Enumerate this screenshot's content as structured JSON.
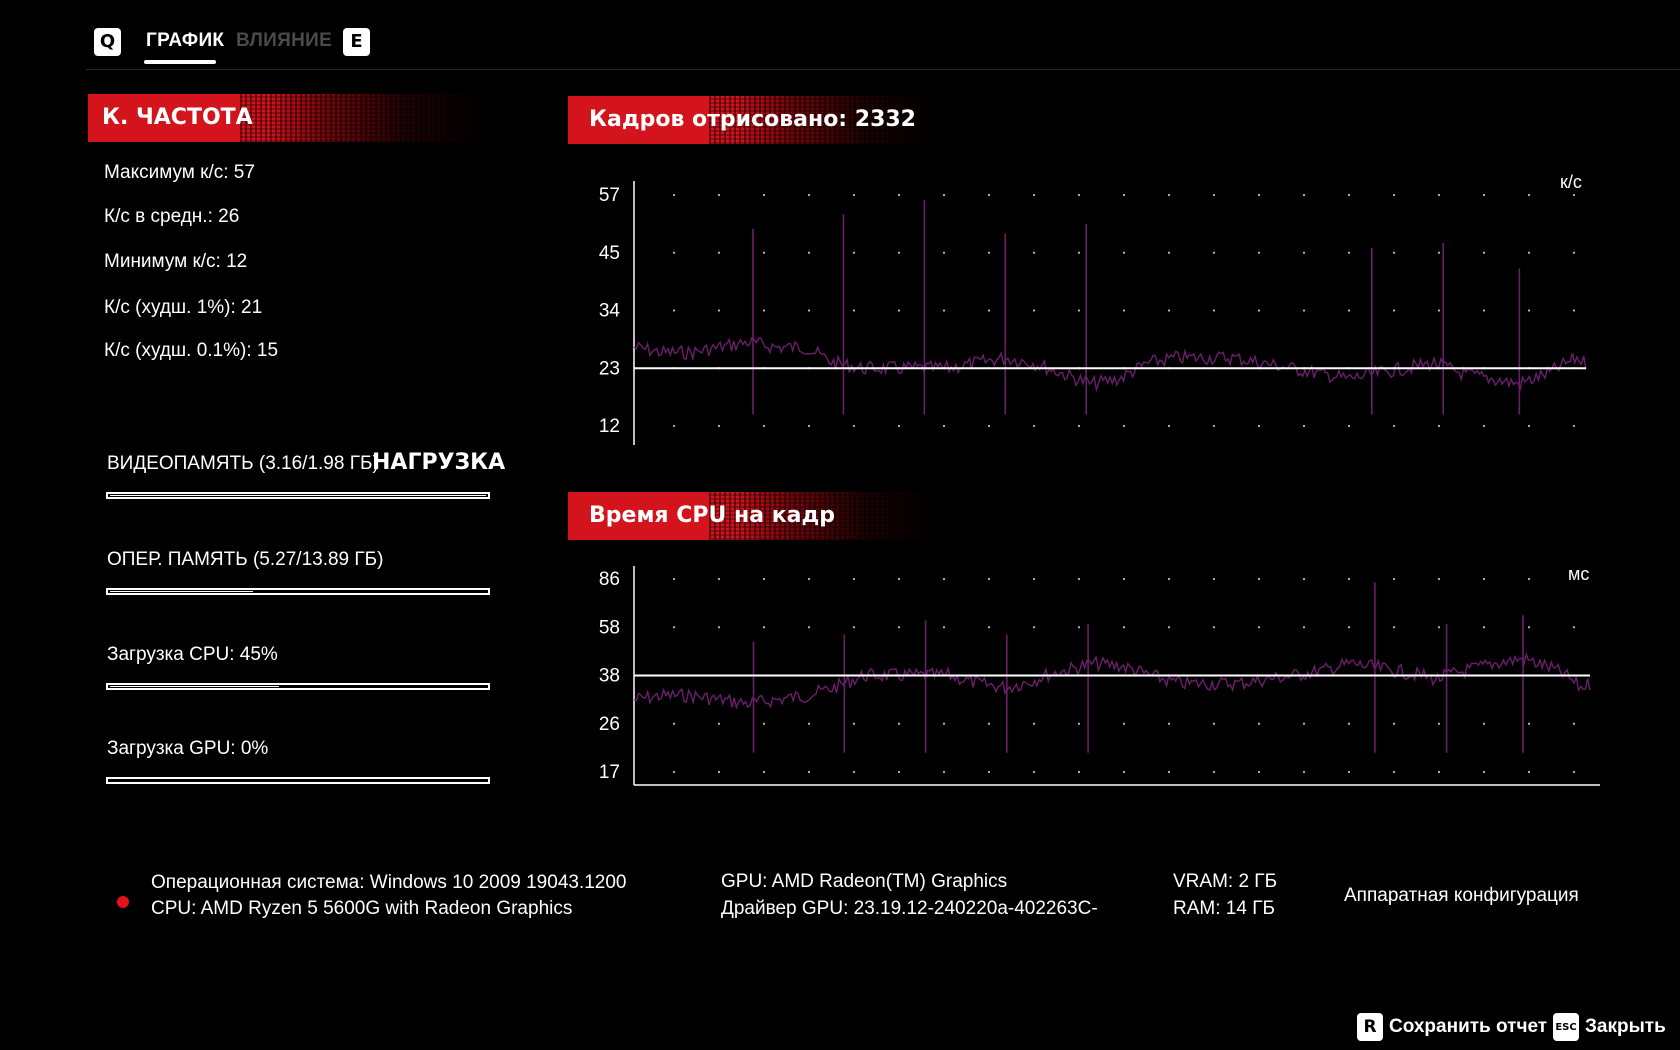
{
  "tabs": {
    "left_key": "Q",
    "right_key": "E",
    "items": [
      {
        "label": "ГРАФИК",
        "active": true
      },
      {
        "label": "ВЛИЯНИЕ",
        "active": false
      }
    ]
  },
  "fps_panel": {
    "title": "К. ЧАСТОТА",
    "stats": [
      "Максимум к/с: 57",
      "К/с в средн.: 26",
      "Минимум к/с: 12",
      "К/с (худш. 1%): 21",
      "К/с (худш. 0.1%): 15"
    ]
  },
  "load": {
    "title": "НАГРУЗКА",
    "items": [
      {
        "label": "ВИДЕОПАМЯТЬ (3.16/1.98 ГБ)",
        "fraction": 1.0
      },
      {
        "label": "ОПЕР. ПАМЯТЬ (5.27/13.89 ГБ)",
        "fraction": 0.38
      },
      {
        "label": "Загрузка CPU: 45%",
        "fraction": 0.45
      },
      {
        "label": "Загрузка GPU: 0%",
        "fraction": 0.0
      }
    ]
  },
  "charts": {
    "fps": {
      "title": "Кадров отрисовано: 2332",
      "unit": "к/с"
    },
    "cpu": {
      "title": "Время CPU на кадр",
      "unit": "мс"
    }
  },
  "chart_data": [
    {
      "type": "line",
      "title": "Кадров отрисовано: 2332",
      "ylabel": "к/с",
      "y_ticks": [
        57,
        45,
        34,
        23,
        12
      ],
      "ylim": [
        12,
        57
      ],
      "reference_line": 23,
      "series": [
        {
          "name": "",
          "color": "#6b1e6b",
          "x": [
            0,
            0.03,
            0.06,
            0.09,
            0.12,
            0.15,
            0.18,
            0.21,
            0.24,
            0.27,
            0.3,
            0.33,
            0.36,
            0.39,
            0.42,
            0.45,
            0.48,
            0.51,
            0.54,
            0.57,
            0.6,
            0.63,
            0.66,
            0.69,
            0.72,
            0.75,
            0.78,
            0.81,
            0.84,
            0.87,
            0.9,
            0.93,
            0.96,
            0.99,
            1.0
          ],
          "values": [
            27,
            26,
            26,
            27,
            28,
            27,
            27,
            24,
            23,
            23,
            23,
            23,
            24,
            25,
            24,
            22,
            20,
            21,
            24,
            25,
            25,
            25,
            24,
            23,
            22,
            21,
            22,
            23,
            24,
            22,
            21,
            20,
            22,
            25,
            24
          ]
        },
        {
          "name": "spikes",
          "color": "#6b1e6b",
          "x": [
            0.125,
            0.22,
            0.305,
            0.39,
            0.475,
            0.775,
            0.85,
            0.93
          ],
          "values": [
            50,
            53,
            56,
            49,
            51,
            46,
            47,
            42
          ]
        }
      ]
    },
    {
      "type": "line",
      "title": "Время CPU на кадр",
      "ylabel": "мс",
      "y_ticks": [
        86,
        58,
        38,
        26,
        17
      ],
      "ylim": [
        17,
        86
      ],
      "reference_line": 38,
      "series": [
        {
          "name": "",
          "color": "#6b1e6b",
          "x": [
            0,
            0.03,
            0.06,
            0.09,
            0.12,
            0.15,
            0.18,
            0.21,
            0.24,
            0.27,
            0.3,
            0.33,
            0.36,
            0.39,
            0.42,
            0.45,
            0.48,
            0.51,
            0.54,
            0.57,
            0.6,
            0.63,
            0.66,
            0.69,
            0.72,
            0.75,
            0.78,
            0.81,
            0.84,
            0.87,
            0.9,
            0.93,
            0.96,
            0.99,
            1.0
          ],
          "values": [
            32,
            33,
            33,
            32,
            31,
            32,
            33,
            35,
            38,
            38,
            38,
            38,
            36,
            35,
            37,
            40,
            43,
            42,
            38,
            36,
            36,
            36,
            37,
            38,
            40,
            43,
            41,
            39,
            37,
            40,
            43,
            45,
            41,
            35,
            36
          ]
        },
        {
          "name": "spikes",
          "color": "#6b1e6b",
          "x": [
            0.125,
            0.22,
            0.305,
            0.39,
            0.475,
            0.775,
            0.85,
            0.93
          ],
          "values": [
            52,
            55,
            62,
            55,
            60,
            84,
            60,
            65
          ]
        }
      ]
    }
  ],
  "system": {
    "os": "Операционная система: Windows 10 2009 19043.1200",
    "cpu": "CPU: AMD Ryzen 5 5600G with Radeon Graphics",
    "gpu": "GPU: AMD Radeon(TM) Graphics",
    "driver": "Драйвер GPU: 23.19.12-240220a-402263C-",
    "vram": "VRAM: 2 ГБ",
    "ram": "RAM: 14 ГБ",
    "hw_config": "Аппаратная конфигурация",
    "accent_color": "#e3121b"
  },
  "footer": {
    "save_key": "R",
    "save_label": "Сохранить отчет",
    "close_key": "ESC",
    "close_label": "Закрыть"
  }
}
